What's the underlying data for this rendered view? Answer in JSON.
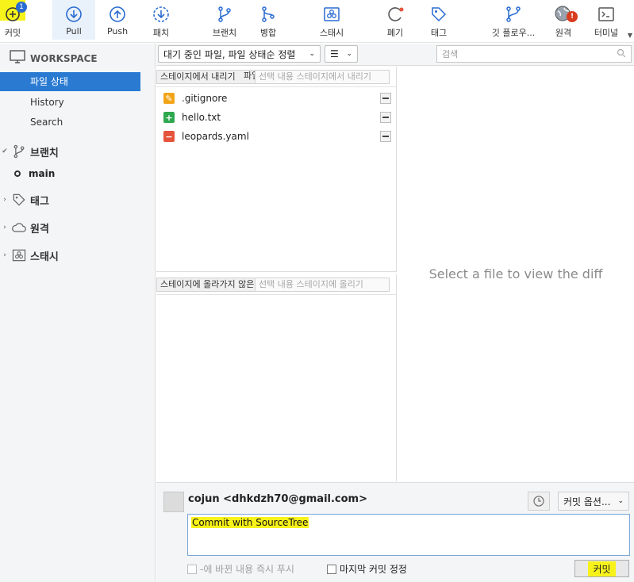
{
  "toolbar": {
    "items": [
      {
        "label": "커밋",
        "icon": "commit-add-icon",
        "badge": "1"
      },
      {
        "label": "Pull",
        "icon": "pull-icon"
      },
      {
        "label": "Push",
        "icon": "push-icon"
      },
      {
        "label": "패치",
        "icon": "fetch-icon"
      },
      {
        "label": "브랜치",
        "icon": "branch-icon"
      },
      {
        "label": "병합",
        "icon": "merge-icon"
      },
      {
        "label": "스태시",
        "icon": "stash-icon"
      },
      {
        "label": "폐기",
        "icon": "discard-icon"
      },
      {
        "label": "태그",
        "icon": "tag-icon"
      },
      {
        "label": "깃 플로우...",
        "icon": "git-flow-icon"
      },
      {
        "label": "원격",
        "icon": "remote-globe-icon",
        "badge": "!"
      },
      {
        "label": "터미널",
        "icon": "terminal-icon"
      }
    ],
    "accent": "#2a6bd1",
    "highlight": "#f7f21a"
  },
  "sidebar": {
    "workspace": "WORKSPACE",
    "items": [
      {
        "label": "파일 상태"
      },
      {
        "label": "History"
      },
      {
        "label": "Search"
      }
    ],
    "groups": [
      {
        "label": "브랜치",
        "icon": "branch-icon"
      },
      {
        "label": "태그",
        "icon": "tag-icon"
      },
      {
        "label": "원격",
        "icon": "cloud-icon"
      },
      {
        "label": "스태시",
        "icon": "stash-icon"
      }
    ],
    "current_branch": "main"
  },
  "filter": {
    "status_select": "대기 중인 파일, 파일 상태순 정렬",
    "view_select": "☰",
    "search_placeholder": "검색"
  },
  "staged": {
    "btn_unstage_all": "스테이지에서 내리기",
    "btn_files": "파일",
    "btn_unstage_selected": "선택 내용 스테이지에서 내리기",
    "files": [
      {
        "name": ".gitignore",
        "status": "modified",
        "color": "#f2a51a",
        "glyph": "✎"
      },
      {
        "name": "hello.txt",
        "status": "added",
        "color": "#2fa84f",
        "glyph": "+"
      },
      {
        "name": "leopards.yaml",
        "status": "removed",
        "color": "#e5533c",
        "glyph": "−"
      }
    ]
  },
  "unstaged": {
    "btn_stage_all": "스테이지에 올라가지 않은 파일",
    "btn_stage_selected": "선택 내용 스테이지에 올리기"
  },
  "diff": {
    "placeholder": "Select a file to view the diff"
  },
  "commit": {
    "author": "cojun <dhkdzh70@gmail.com>",
    "options": "커밋 옵션...",
    "message": "Commit with SourceTree",
    "push_immediately": "-에 바뀐 내용 즉시 푸시",
    "amend_last": "마지막 커밋 정정",
    "commit_button": "커밋"
  }
}
